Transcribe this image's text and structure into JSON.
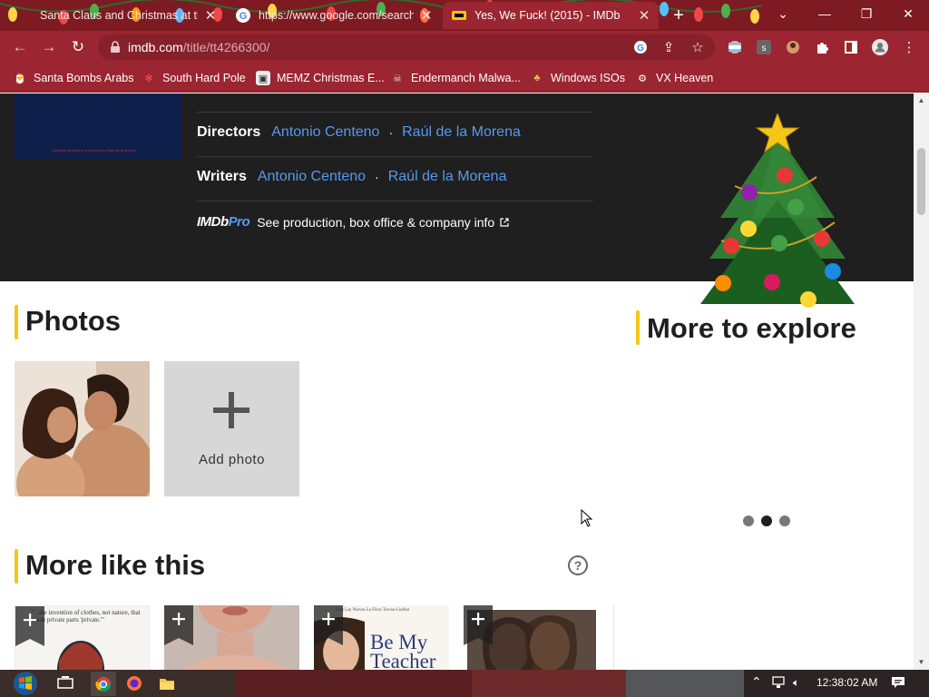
{
  "browser": {
    "tabs": [
      {
        "title": "Santa Claus and Christmas at the",
        "active": false
      },
      {
        "title": "https://www.google.com/search",
        "active": false
      },
      {
        "title": "Yes, We Fuck! (2015) - IMDb",
        "active": true
      }
    ],
    "new_tab": "+",
    "url_host": "imdb.com",
    "url_path": "/title/tt4266300/",
    "bookmarks": [
      {
        "label": "Santa Bombs Arabs",
        "icon": "santa-icon"
      },
      {
        "label": "South Hard Pole",
        "icon": "snowflake-icon"
      },
      {
        "label": "MEMZ Christmas E...",
        "icon": "memz-icon"
      },
      {
        "label": "Endermanch Malwa...",
        "icon": "skull-icon"
      },
      {
        "label": "Windows ISOs",
        "icon": "tree-icon"
      },
      {
        "label": "VX Heaven",
        "icon": "vx-icon"
      }
    ]
  },
  "page": {
    "credits": [
      {
        "label": "Directors",
        "names": [
          "Antonio Centeno",
          "Raúl de la Morena"
        ]
      },
      {
        "label": "Writers",
        "names": [
          "Antonio Centeno",
          "Raúl de la Morena"
        ]
      }
    ],
    "imdbpro_logo_a": "IMDb",
    "imdbpro_logo_b": "Pro",
    "imdbpro_text": "See production, box office & company info",
    "poster_credit": "Directed by Antonio Centeno and Raúl de la Morena",
    "photos_title": "Photos",
    "add_photo": "Add photo",
    "explore_title": "More to explore",
    "more_like_title": "More like this",
    "help": "?",
    "card1_text": "\"...the invention of clothes, not nature, that made private parts 'private.'\"",
    "card3_top": "Luis Las Nieves      La Fiera Towns-Cuellar",
    "card3_title": "Be My Teacher",
    "carousel_active_index": 1
  },
  "taskbar": {
    "time": "12:38:02 AM"
  }
}
